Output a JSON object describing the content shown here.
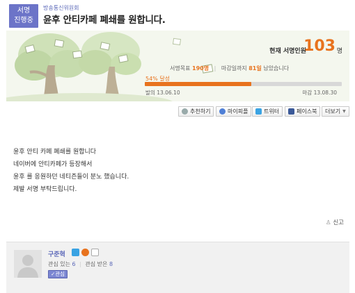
{
  "header": {
    "status_line1": "서명",
    "status_line2": "진행중",
    "category": "방송통신위원회",
    "title": "윤후 안티카페 폐쇄를 원합니다."
  },
  "stats": {
    "current_label": "현재 서명인원",
    "current_value": "103",
    "current_unit": "명",
    "goal_label": "서명목표",
    "goal_value": "190명",
    "deadline_prefix": "마감일까지",
    "deadline_days": "81일",
    "deadline_suffix": "남았습니다",
    "progress_label": "54% 달성",
    "progress_fraction": 0.54,
    "start_label": "발의",
    "start_date": "13.06.10",
    "end_label": "마감",
    "end_date": "13.08.30"
  },
  "actions": {
    "recommend": "추천하기",
    "mypeople": "마이피플",
    "twitter": "트위터",
    "facebook": "페이스북",
    "more": "더보기"
  },
  "body": {
    "lines": [
      "윤후 안티 카페 폐쇄를 원합니다",
      "네이버에 안티카페가 등장해서",
      "윤후 를 응원하던 네티즌들이 분노 했습니다.",
      "제발 서명 부탁드립니다."
    ],
    "report": "신고"
  },
  "author": {
    "name": "구준혁",
    "following_label": "관심 있는",
    "following_count": "6",
    "followers_label": "관심 받은",
    "followers_count": "8",
    "follow_button": "관심"
  },
  "colors": {
    "accent": "#e8731e",
    "brand": "#6c74c8",
    "banner_bg": "#f4f7ee"
  }
}
